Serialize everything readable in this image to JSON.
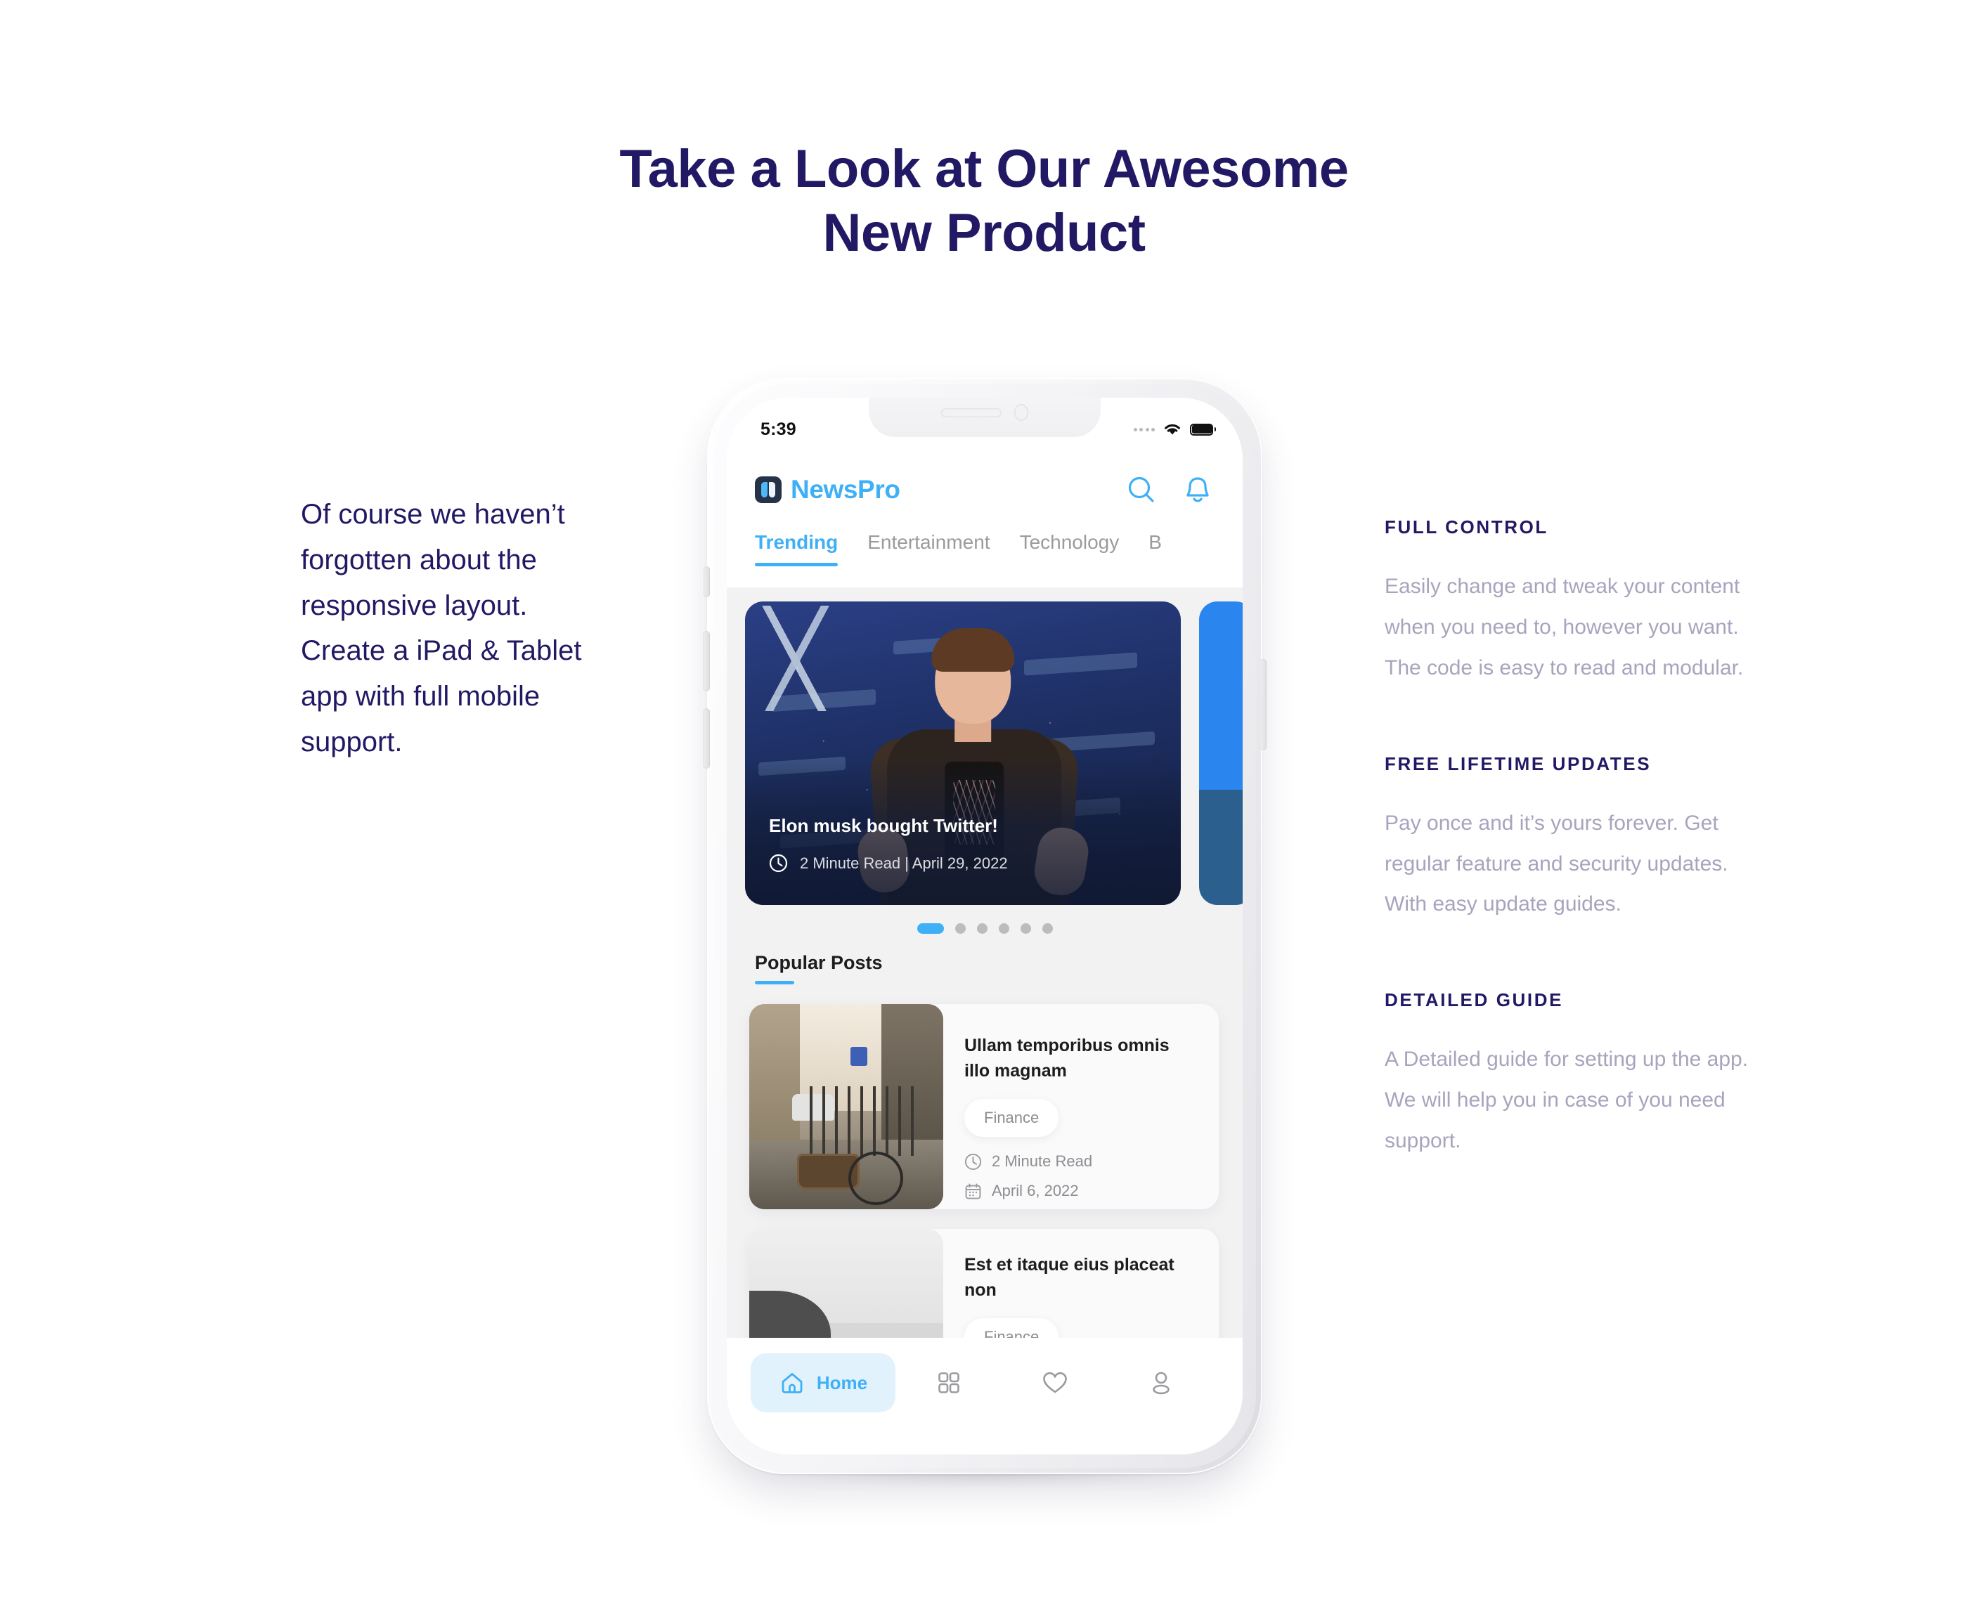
{
  "headline": {
    "line1": "Take a Look at Our Awesome",
    "line2": "New Product"
  },
  "left_column": {
    "paragraph": "Of course we haven’t forgotten about the responsive layout. Create a iPad & Tablet app with full mobile support."
  },
  "features": [
    {
      "title": "FULL CONTROL",
      "body": "Easily change and tweak your content when you need to, however you want. The code is easy to read and modular."
    },
    {
      "title": "FREE LIFETIME UPDATES",
      "body": "Pay once and it’s yours forever. Get regular feature and security updates. With easy update guides."
    },
    {
      "title": "DETAILED GUIDE",
      "body": "A Detailed guide for setting up the app. We will help you in case of you need support."
    }
  ],
  "phone": {
    "status_bar": {
      "time": "5:39",
      "signal_icon": "signal-dots-icon",
      "wifi_icon": "wifi-icon",
      "battery_icon": "battery-full-icon"
    },
    "app_header": {
      "logo_icon": "newspro-logo-icon",
      "brand": "NewsPro",
      "search_icon": "search-icon",
      "bell_icon": "bell-icon"
    },
    "tabs": [
      {
        "label": "Trending",
        "active": true
      },
      {
        "label": "Entertainment",
        "active": false
      },
      {
        "label": "Technology",
        "active": false
      },
      {
        "label": "B",
        "active": false
      }
    ],
    "hero": {
      "title": "Elon musk bought Twitter!",
      "clock_icon": "clock-icon",
      "meta": "2  Minute Read | April 29, 2022",
      "dots_total": 6,
      "dots_active_index": 0
    },
    "section": {
      "title": "Popular Posts"
    },
    "posts": [
      {
        "title": "Ullam temporibus omnis illo magnam",
        "tag": "Finance",
        "read_time": "2 Minute Read",
        "date": "April 6, 2022",
        "clock_icon": "clock-icon",
        "calendar_icon": "calendar-icon",
        "thumb": "street-bicycle-photo"
      },
      {
        "title": "Est et itaque eius placeat non",
        "tag": "Finance",
        "thumb": "beach-surfer-photo"
      }
    ],
    "bottom_nav": [
      {
        "label": "Home",
        "icon": "home-icon",
        "active": true
      },
      {
        "label": "",
        "icon": "grid-icon",
        "active": false
      },
      {
        "label": "",
        "icon": "heart-icon",
        "active": false
      },
      {
        "label": "",
        "icon": "person-icon",
        "active": false
      }
    ]
  },
  "colors": {
    "accent_blue": "#3fb0f5",
    "headline_navy": "#221964",
    "body_gray": "#a7a4bd",
    "screen_bg": "#f2f2f3"
  }
}
